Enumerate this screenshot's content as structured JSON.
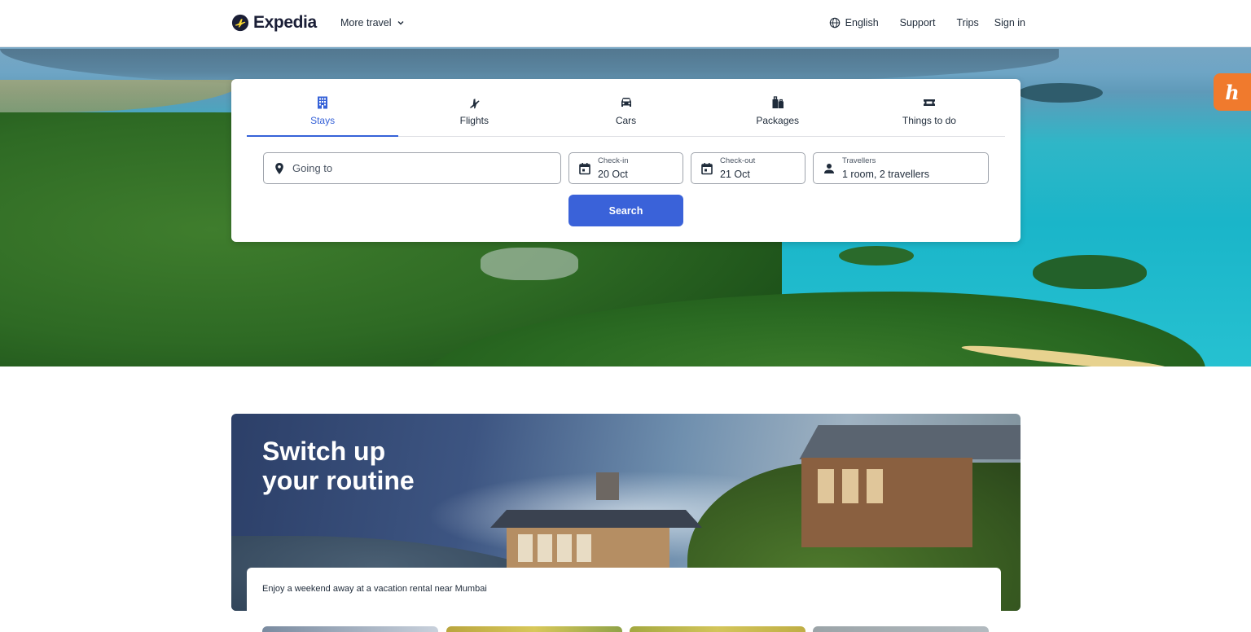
{
  "header": {
    "brand": "Expedia",
    "more_travel": "More travel",
    "language": "English",
    "support": "Support",
    "trips": "Trips",
    "sign_in": "Sign in"
  },
  "search": {
    "tabs": [
      {
        "label": "Stays",
        "icon": "building-icon",
        "active": true
      },
      {
        "label": "Flights",
        "icon": "plane-icon",
        "active": false
      },
      {
        "label": "Cars",
        "icon": "car-icon",
        "active": false
      },
      {
        "label": "Packages",
        "icon": "luggage-icon",
        "active": false
      },
      {
        "label": "Things to do",
        "icon": "ticket-icon",
        "active": false
      }
    ],
    "going_to": {
      "placeholder": "Going to"
    },
    "check_in": {
      "label": "Check-in",
      "value": "20 Oct"
    },
    "check_out": {
      "label": "Check-out",
      "value": "21 Oct"
    },
    "travellers": {
      "label": "Travellers",
      "value": "1 room, 2 travellers"
    },
    "button": "Search"
  },
  "extension": {
    "label": "h"
  },
  "promo": {
    "title_line1": "Switch up",
    "title_line2": "your routine",
    "subtitle": "Enjoy a weekend away at a vacation rental near Mumbai"
  },
  "colors": {
    "accent": "#3662d8",
    "button": "#3a62d9",
    "brand_dark": "#1a1e36",
    "extension_orange": "#f07a2d"
  }
}
